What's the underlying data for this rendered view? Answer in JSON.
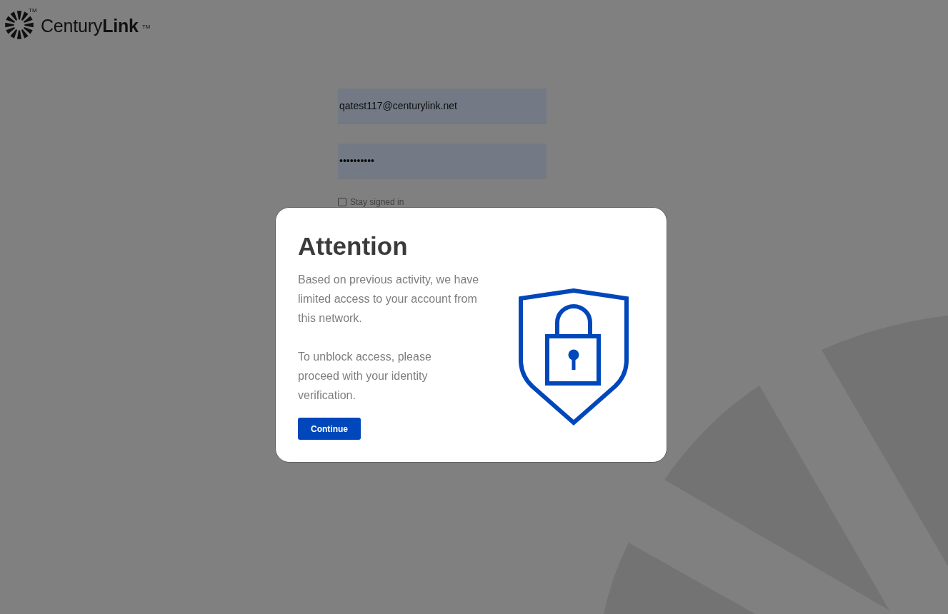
{
  "logo": {
    "icon_trademark": "TM",
    "wordmark": "Century**Link**",
    "trademark": "TM"
  },
  "login_form": {
    "email": {
      "value": "qatest117@centurylink.net"
    },
    "password": {
      "value": "••••••••••"
    },
    "stay_signed_in": {
      "label": "Stay signed in",
      "checked": false
    }
  },
  "dialog": {
    "title": "Attention",
    "paragraphs": [
      "Based on previous activity, we have limited access to your account from this network.",
      "To unblock access, please proceed with your identity verification."
    ],
    "button": "Continue"
  }
}
